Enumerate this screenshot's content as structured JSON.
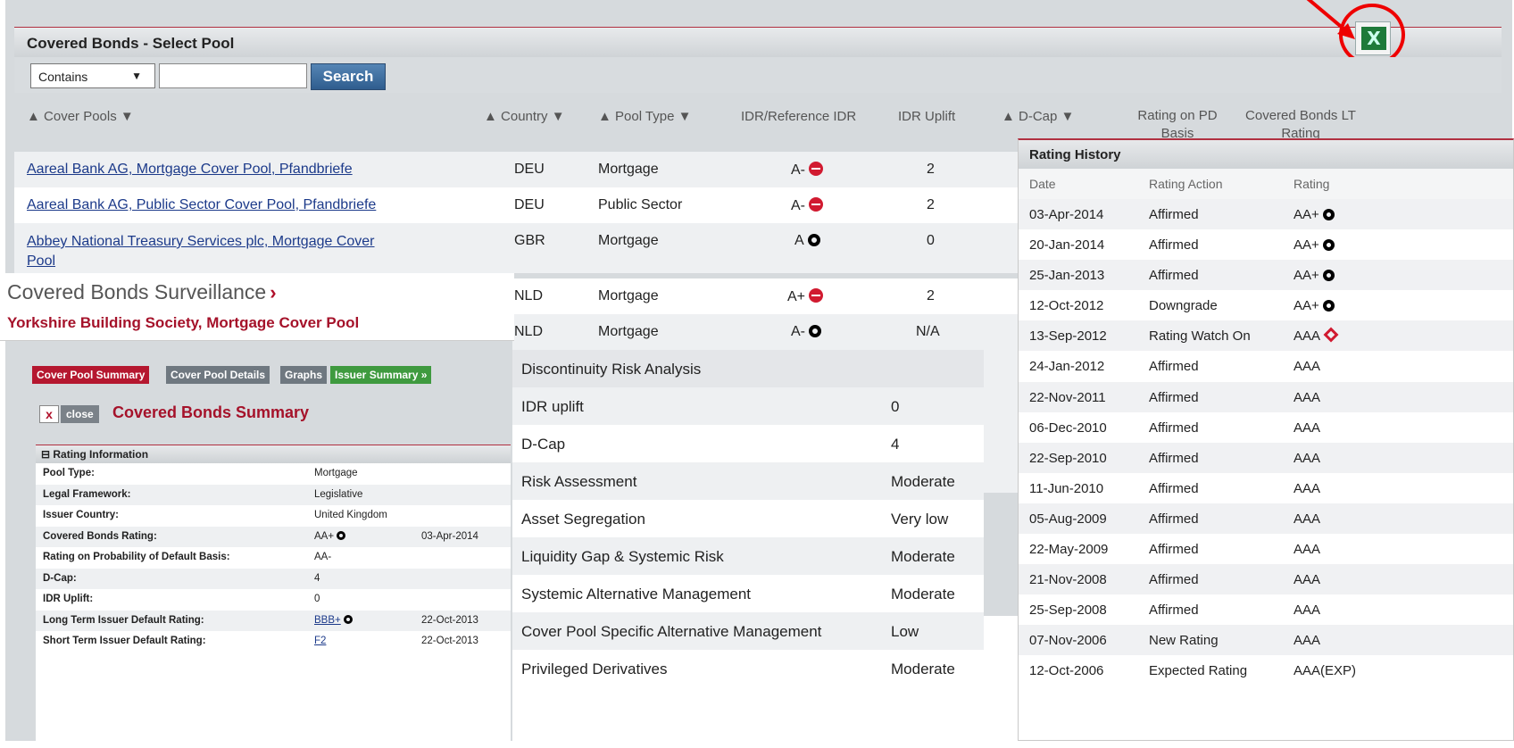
{
  "panel": {
    "title": "Covered Bonds - Select Pool",
    "filter_select": "Contains",
    "search_value": "",
    "search_label": "Search"
  },
  "columns": {
    "cover_pools": "▲ Cover Pools ▼",
    "country": "▲ Country ▼",
    "pool_type": "▲ Pool Type ▼",
    "idr": "IDR/Reference IDR",
    "idr_uplift": "IDR Uplift",
    "dcap": "▲ D-Cap ▼",
    "rating_pd": "Rating on PD Basis",
    "cb_lt": "Covered Bonds LT Rating"
  },
  "pools": [
    {
      "name": "Aareal Bank AG, Mortgage Cover Pool, Pfandbriefe",
      "country": "DEU",
      "type": "Mortgage",
      "idr": "A-",
      "idr_icon": "minus",
      "uplift": "2"
    },
    {
      "name": "Aareal Bank AG, Public Sector Cover Pool, Pfandbriefe",
      "country": "DEU",
      "type": "Public Sector",
      "idr": "A-",
      "idr_icon": "minus",
      "uplift": "2"
    },
    {
      "name": "Abbey National Treasury Services plc, Mortgage Cover",
      "name2": "Pool",
      "country": "GBR",
      "type": "Mortgage",
      "idr": "A",
      "idr_icon": "ring",
      "uplift": "0"
    },
    {
      "country": "NLD",
      "type": "Mortgage",
      "idr": "A+",
      "idr_icon": "minus",
      "uplift": "2"
    },
    {
      "country": "NLD",
      "type": "Mortgage",
      "idr": "A-",
      "idr_icon": "ring",
      "uplift": "N/A"
    }
  ],
  "surveillance": {
    "title": "Covered Bonds Surveillance",
    "chevron": "›",
    "subtitle": "Yorkshire Building Society, Mortgage Cover Pool"
  },
  "tabs": {
    "summary": "Cover Pool Summary",
    "details": "Cover Pool Details",
    "graphs": "Graphs",
    "issuer": "Issuer Summary »"
  },
  "summary": {
    "close_x": "x",
    "close_label": "close",
    "title": "Covered Bonds Summary"
  },
  "rating_info": {
    "header": "⊟ Rating Information",
    "rows": [
      {
        "label": "Pool Type:",
        "value": "Mortgage",
        "date": ""
      },
      {
        "label": "Legal Framework:",
        "value": "Legislative",
        "date": ""
      },
      {
        "label": "Issuer Country:",
        "value": "United Kingdom",
        "date": ""
      },
      {
        "label": "Covered Bonds Rating:",
        "value": "AA+",
        "date": "03-Apr-2014"
      },
      {
        "label": "Rating on Probability of Default Basis:",
        "value": "AA-",
        "date": ""
      },
      {
        "label": "D-Cap:",
        "value": "4",
        "date": ""
      },
      {
        "label": "IDR Uplift:",
        "value": "0",
        "date": ""
      },
      {
        "label": "Long Term Issuer Default Rating:",
        "value": "BBB+",
        "date": "22-Oct-2013"
      },
      {
        "label": "Short Term Issuer Default Rating:",
        "value": "F2",
        "date": "22-Oct-2013"
      }
    ]
  },
  "discontinuity": {
    "rows": [
      {
        "label": "Discontinuity Risk Analysis",
        "value": ""
      },
      {
        "label": "IDR uplift",
        "value": "0"
      },
      {
        "label": "D-Cap",
        "value": "4"
      },
      {
        "label": "Risk Assessment",
        "value": "Moderate"
      },
      {
        "label": "Asset Segregation",
        "value": "Very low"
      },
      {
        "label": "Liquidity Gap & Systemic Risk",
        "value": "Moderate"
      },
      {
        "label": "Systemic Alternative Management",
        "value": "Moderate"
      },
      {
        "label": "Cover Pool Specific Alternative Management",
        "value": "Low"
      },
      {
        "label": "Privileged Derivatives",
        "value": "Moderate"
      }
    ]
  },
  "rating_history": {
    "title": "Rating History",
    "col_date": "Date",
    "col_action": "Rating Action",
    "col_rating": "Rating",
    "rows": [
      {
        "date": "03-Apr-2014",
        "action": "Affirmed",
        "rating": "AA+",
        "icon": "ring"
      },
      {
        "date": "20-Jan-2014",
        "action": "Affirmed",
        "rating": "AA+",
        "icon": "ring"
      },
      {
        "date": "25-Jan-2013",
        "action": "Affirmed",
        "rating": "AA+",
        "icon": "ring"
      },
      {
        "date": "12-Oct-2012",
        "action": "Downgrade",
        "rating": "AA+",
        "icon": "ring"
      },
      {
        "date": "13-Sep-2012",
        "action": "Rating Watch On",
        "rating": "AAA",
        "icon": "diamond"
      },
      {
        "date": "24-Jan-2012",
        "action": "Affirmed",
        "rating": "AAA",
        "icon": ""
      },
      {
        "date": "22-Nov-2011",
        "action": "Affirmed",
        "rating": "AAA",
        "icon": ""
      },
      {
        "date": "06-Dec-2010",
        "action": "Affirmed",
        "rating": "AAA",
        "icon": ""
      },
      {
        "date": "22-Sep-2010",
        "action": "Affirmed",
        "rating": "AAA",
        "icon": ""
      },
      {
        "date": "11-Jun-2010",
        "action": "Affirmed",
        "rating": "AAA",
        "icon": ""
      },
      {
        "date": "05-Aug-2009",
        "action": "Affirmed",
        "rating": "AAA",
        "icon": ""
      },
      {
        "date": "22-May-2009",
        "action": "Affirmed",
        "rating": "AAA",
        "icon": ""
      },
      {
        "date": "21-Nov-2008",
        "action": "Affirmed",
        "rating": "AAA",
        "icon": ""
      },
      {
        "date": "25-Sep-2008",
        "action": "Affirmed",
        "rating": "AAA",
        "icon": ""
      },
      {
        "date": "07-Nov-2006",
        "action": "New Rating",
        "rating": "AAA",
        "icon": ""
      },
      {
        "date": "12-Oct-2006",
        "action": "Expected Rating",
        "rating": "AAA(EXP)",
        "icon": ""
      }
    ]
  },
  "colors": {
    "brand_red": "#a5122a",
    "link": "#1c3a8a",
    "tab_active": "#b5172f",
    "tab_inactive": "#6f7880",
    "tab_issuer": "#3f9a3f"
  }
}
